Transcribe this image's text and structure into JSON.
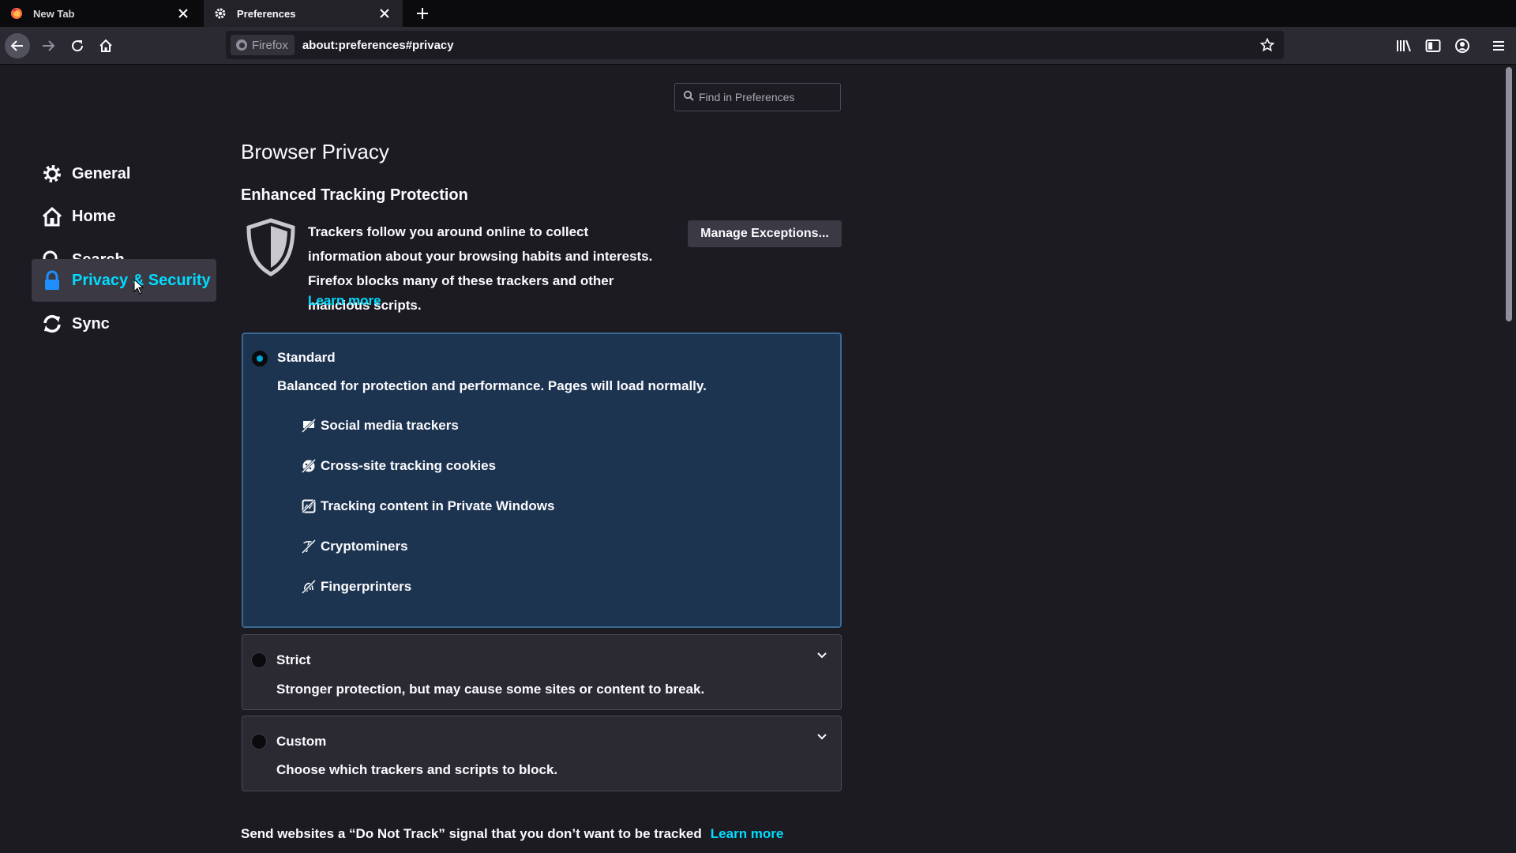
{
  "tabs": [
    {
      "label": "New Tab",
      "icon": "firefox-icon"
    },
    {
      "label": "Preferences",
      "icon": "gear-icon"
    }
  ],
  "urlbar": {
    "identity_label": "Firefox",
    "url": "about:preferences#privacy"
  },
  "search": {
    "placeholder": "Find in Preferences"
  },
  "sidebar": {
    "items": [
      {
        "label": "General",
        "icon": "gear-icon"
      },
      {
        "label": "Home",
        "icon": "home-icon"
      },
      {
        "label": "Search",
        "icon": "search-icon"
      },
      {
        "label": "Privacy & Security",
        "icon": "lock-icon",
        "selected": true
      },
      {
        "label": "Sync",
        "icon": "sync-icon"
      }
    ]
  },
  "main": {
    "heading": "Browser Privacy",
    "etp": {
      "heading": "Enhanced Tracking Protection",
      "description": "Trackers follow you around online to collect information about your browsing habits and interests. Firefox blocks many of these trackers and other malicious scripts.",
      "learn_more": "Learn more",
      "manage_button": "Manage Exceptions..."
    },
    "options": [
      {
        "label": "Standard",
        "description": "Balanced for protection and performance. Pages will load normally.",
        "selected": true,
        "blocks": [
          "Social media trackers",
          "Cross-site tracking cookies",
          "Tracking content in Private Windows",
          "Cryptominers",
          "Fingerprinters"
        ]
      },
      {
        "label": "Strict",
        "description": "Stronger protection, but may cause some sites or content to break.",
        "selected": false
      },
      {
        "label": "Custom",
        "description": "Choose which trackers and scripts to block.",
        "selected": false
      }
    ],
    "dnt": {
      "text": "Send websites a “Do Not Track” signal that you don’t want to be tracked",
      "learn_more": "Learn more"
    }
  },
  "colors": {
    "accent": "#00ddff",
    "standard_bg": "#1d3450",
    "page_bg": "#1c1b22"
  }
}
